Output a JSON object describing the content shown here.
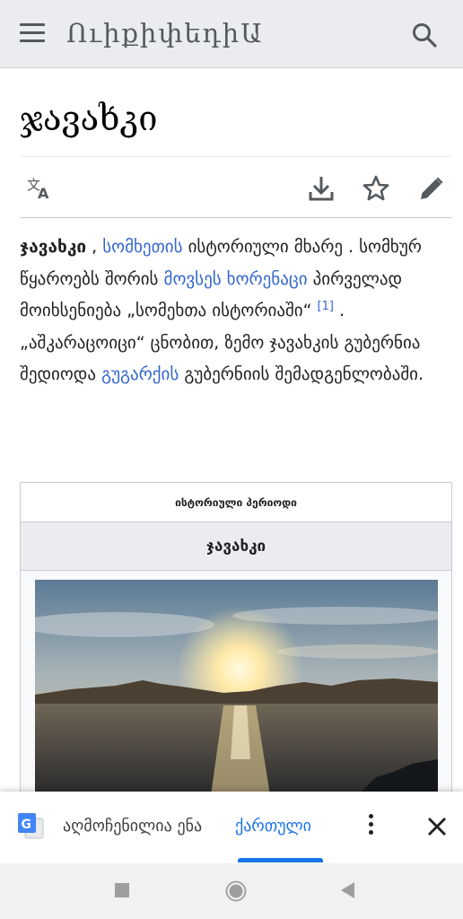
{
  "header": {
    "wordmark": "ՈւիքիփեդիԱ",
    "menu_icon": "hamburger-menu-icon",
    "search_icon": "search-icon"
  },
  "page": {
    "title": "ჯავახკი"
  },
  "toolbar": {
    "language_icon": "translate-language-icon",
    "download_icon": "download-icon",
    "watch_icon": "star-icon",
    "edit_icon": "pencil-icon"
  },
  "article": {
    "bold_term": "ჯავახკი",
    "t1": " , ",
    "link_armenia": "სომხეთის",
    "t2": " ისტორიული მხარე . სომხურ წყაროებს შორის ",
    "link_movses": "მოვსეს ხორენაცი",
    "t3": " პირველად მოიხსენიება „სომეხთა ისტორიაში“ ",
    "ref": "[1]",
    "t4": " . „აშკარაცოიცი“ ცნობით, ზემო ჯავახკის გუბერნია შედიოდა ",
    "link_gugark": "გუგარქის",
    "t5": " გუბერნიის შემადგენლობაში."
  },
  "infobox": {
    "top_label": "ისტორიული პერიოდი",
    "header": "ჯავახკი"
  },
  "translate_bar": {
    "icon": "google-translate-icon",
    "detected_label": "აღმოჩენილია ენა",
    "language_tab": "ქართული",
    "more_icon": "more-vert-icon",
    "close_icon": "close-icon"
  },
  "navbar": {
    "recents_icon": "square-recents-icon",
    "home_icon": "circle-home-icon",
    "back_icon": "triangle-back-icon"
  },
  "colors": {
    "link": "#3366cc",
    "header_bg": "#eaecf0",
    "translate_accent": "#1a73e8"
  }
}
